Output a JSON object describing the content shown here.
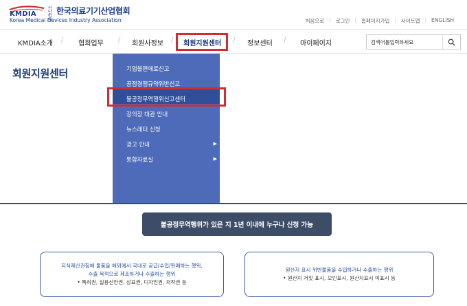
{
  "brand": {
    "abbr": "KMDIA",
    "small": "사단법인",
    "name_kr": "한국의료기기산업협회",
    "name_en": "Korea Medical Devices Industry Association"
  },
  "util_links": [
    "처음으로",
    "로그인",
    "홈페이지가입",
    "사이트맵",
    "ENGLISH"
  ],
  "nav": {
    "items": [
      "KMDIA소개",
      "협회업무",
      "회원사정보",
      "회원지원센터",
      "정보센터",
      "마이페이지"
    ],
    "separator": "/",
    "highlight_color": "#d52a30"
  },
  "search": {
    "placeholder": "검색어를입력하세요"
  },
  "page_title": "회원지원센터",
  "dropdown": {
    "items": [
      {
        "label": "기업불편애로신고",
        "has_arrow": false
      },
      {
        "label": "공정경쟁규약위반신고",
        "has_arrow": false
      },
      {
        "label": "불공정무역행위신고센터",
        "has_arrow": false
      },
      {
        "label": "강의장 대관 안내",
        "has_arrow": false
      },
      {
        "label": "뉴스레터 신청",
        "has_arrow": false
      },
      {
        "label": "광고 안내",
        "has_arrow": true
      },
      {
        "label": "통합자료실",
        "has_arrow": true
      }
    ],
    "arrow_glyph": "▶",
    "bg_color": "#4d6bb8"
  },
  "notice_pill": "불공정무역행위가 있은 지 1년 이내에 누구나 신청 가능",
  "boxes": [
    {
      "line1": "지식재산권침해 물품을 해외에서 국내로 공급/수입/판매하는 행위,",
      "line2": "수출 목적으로 제조하거나 수출하는 행위",
      "line3": "• 특허권, 실용신안권, 상표권, 디자인권, 저작권 등"
    },
    {
      "line1": "원산지 표시 위반물품을 수입하거나 수출하는 행위",
      "line2": "",
      "line3": "• 원산지 거짓 표시, 오인표시, 원산지표시 미표시 등"
    }
  ]
}
